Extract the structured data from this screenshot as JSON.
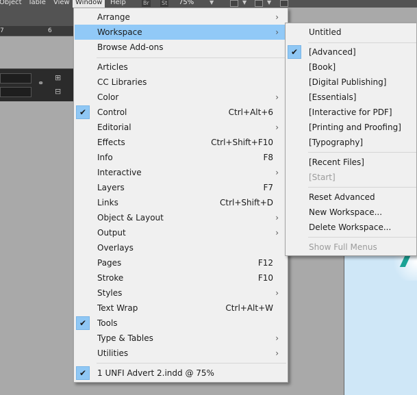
{
  "menubar": {
    "items": [
      "Object",
      "Table",
      "View",
      "Window",
      "Help"
    ],
    "bridge_label": "Br",
    "stock_label": "St",
    "zoom": "75%"
  },
  "ruler": {
    "tick_7": "7",
    "tick_6": "6"
  },
  "window_menu": {
    "items": [
      {
        "label": "Arrange",
        "submenu": true
      },
      {
        "label": "Workspace",
        "submenu": true,
        "highlighted": true
      },
      {
        "label": "Browse Add-ons"
      },
      {
        "label": "Articles"
      },
      {
        "label": "CC Libraries"
      },
      {
        "label": "Color",
        "submenu": true
      },
      {
        "label": "Control",
        "shortcut": "Ctrl+Alt+6",
        "checked": true
      },
      {
        "label": "Editorial",
        "submenu": true
      },
      {
        "label": "Effects",
        "shortcut": "Ctrl+Shift+F10"
      },
      {
        "label": "Info",
        "shortcut": "F8"
      },
      {
        "label": "Interactive",
        "submenu": true
      },
      {
        "label": "Layers",
        "shortcut": "F7"
      },
      {
        "label": "Links",
        "shortcut": "Ctrl+Shift+D"
      },
      {
        "label": "Object & Layout",
        "submenu": true
      },
      {
        "label": "Output",
        "submenu": true
      },
      {
        "label": "Overlays"
      },
      {
        "label": "Pages",
        "shortcut": "F12"
      },
      {
        "label": "Stroke",
        "shortcut": "F10"
      },
      {
        "label": "Styles",
        "submenu": true
      },
      {
        "label": "Text Wrap",
        "shortcut": "Ctrl+Alt+W"
      },
      {
        "label": "Tools",
        "checked": true
      },
      {
        "label": "Type & Tables",
        "submenu": true
      },
      {
        "label": "Utilities",
        "submenu": true
      },
      {
        "label": "1 UNFI Advert 2.indd @ 75%",
        "checked": true
      }
    ]
  },
  "workspace_menu": {
    "items": [
      {
        "label": "Untitled"
      },
      {
        "label": "[Advanced]",
        "checked": true
      },
      {
        "label": "[Book]"
      },
      {
        "label": "[Digital Publishing]"
      },
      {
        "label": "[Essentials]"
      },
      {
        "label": "[Interactive for PDF]"
      },
      {
        "label": "[Printing and Proofing]"
      },
      {
        "label": "[Typography]"
      },
      {
        "label": "[Recent Files]"
      },
      {
        "label": "[Start]",
        "disabled": true
      },
      {
        "label": "Reset Advanced"
      },
      {
        "label": "New Workspace..."
      },
      {
        "label": "Delete Workspace..."
      },
      {
        "label": "Show Full Menus",
        "disabled": true
      }
    ]
  },
  "icons": {
    "checkmark": "check-icon",
    "submenu_arrow": "chevron-right-icon"
  },
  "colors": {
    "highlight": "#91c9f7",
    "menu_bg": "#f0f0f0",
    "app_chrome": "#535353",
    "page_bg": "#cfe7f7",
    "accent": "#1aa396"
  }
}
